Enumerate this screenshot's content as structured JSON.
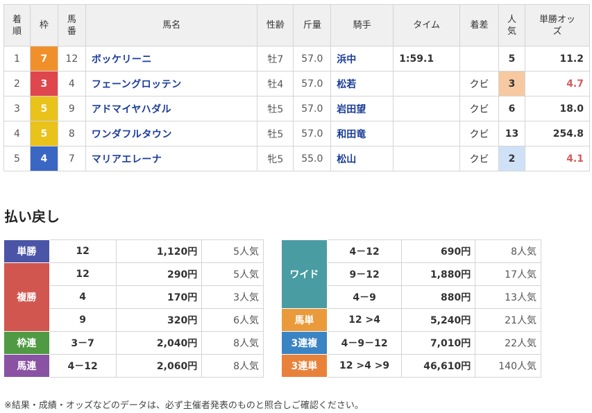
{
  "results": {
    "headers": [
      "着順",
      "枠",
      "馬番",
      "馬名",
      "性齢",
      "斤量",
      "騎手",
      "タイム",
      "着差",
      "人気",
      "単勝オッズ"
    ],
    "rows": [
      {
        "rank": "1",
        "frame": "7",
        "frame_color": "#f0902a",
        "num": "12",
        "horse": "ボッケリーニ",
        "sexage": "牡7",
        "weight": "57.0",
        "jockey": "浜中",
        "time": "1:59.1",
        "margin": "",
        "pop": "5",
        "odds": "11.2",
        "pop_class": "",
        "odds_class": ""
      },
      {
        "rank": "2",
        "frame": "3",
        "frame_color": "#e0464d",
        "num": "4",
        "horse": "フェーングロッテン",
        "sexage": "牡4",
        "weight": "57.0",
        "jockey": "松若",
        "time": "",
        "margin": "クビ",
        "pop": "3",
        "odds": "4.7",
        "pop_class": "p1",
        "odds_class": "fav"
      },
      {
        "rank": "3",
        "frame": "5",
        "frame_color": "#e9c21a",
        "num": "9",
        "horse": "アドマイヤハダル",
        "sexage": "牡5",
        "weight": "57.0",
        "jockey": "岩田望",
        "time": "",
        "margin": "クビ",
        "pop": "6",
        "odds": "18.0",
        "pop_class": "",
        "odds_class": ""
      },
      {
        "rank": "4",
        "frame": "5",
        "frame_color": "#e9c21a",
        "num": "8",
        "horse": "ワンダフルタウン",
        "sexage": "牡5",
        "weight": "57.0",
        "jockey": "和田竜",
        "time": "",
        "margin": "クビ",
        "pop": "13",
        "odds": "254.8",
        "pop_class": "",
        "odds_class": ""
      },
      {
        "rank": "5",
        "frame": "4",
        "frame_color": "#3a66c4",
        "num": "7",
        "horse": "マリアエレーナ",
        "sexage": "牝5",
        "weight": "55.0",
        "jockey": "松山",
        "time": "",
        "margin": "クビ",
        "pop": "2",
        "odds": "4.1",
        "pop_class": "p2",
        "odds_class": "fav"
      }
    ]
  },
  "payout_title": "払い戻し",
  "payout_left": [
    {
      "label": "単勝",
      "color": "#4a55a8",
      "entries": [
        {
          "nums": "12",
          "yen": "1,120円",
          "pop": "5人気"
        }
      ]
    },
    {
      "label": "複勝",
      "color": "#d1564f",
      "entries": [
        {
          "nums": "12",
          "yen": "290円",
          "pop": "5人気"
        },
        {
          "nums": "4",
          "yen": "170円",
          "pop": "3人気"
        },
        {
          "nums": "9",
          "yen": "320円",
          "pop": "6人気"
        }
      ]
    },
    {
      "label": "枠連",
      "color": "#4f9a43",
      "entries": [
        {
          "nums": "3－7",
          "yen": "2,040円",
          "pop": "8人気"
        }
      ]
    },
    {
      "label": "馬連",
      "color": "#8a52a3",
      "entries": [
        {
          "nums": "4－12",
          "yen": "2,060円",
          "pop": "8人気"
        }
      ]
    }
  ],
  "payout_right": [
    {
      "label": "ワイド",
      "color": "#4a9ca3",
      "entries": [
        {
          "nums": "4－12",
          "yen": "690円",
          "pop": "8人気"
        },
        {
          "nums": "9－12",
          "yen": "1,880円",
          "pop": "17人気"
        },
        {
          "nums": "4－9",
          "yen": "880円",
          "pop": "13人気"
        }
      ]
    },
    {
      "label": "馬単",
      "color": "#eb9a3b",
      "entries": [
        {
          "nums": "12 >4",
          "yen": "5,240円",
          "pop": "21人気"
        }
      ]
    },
    {
      "label": "3連複",
      "color": "#3b84c4",
      "entries": [
        {
          "nums": "4－9－12",
          "yen": "7,010円",
          "pop": "22人気"
        }
      ]
    },
    {
      "label": "3連単",
      "color": "#e8823a",
      "entries": [
        {
          "nums": "12 >4 >9",
          "yen": "46,610円",
          "pop": "140人気"
        }
      ]
    }
  ],
  "disclaimer": "※結果・成績・オッズなどのデータは、必ず主催者発表のものと照合しご確認ください。"
}
